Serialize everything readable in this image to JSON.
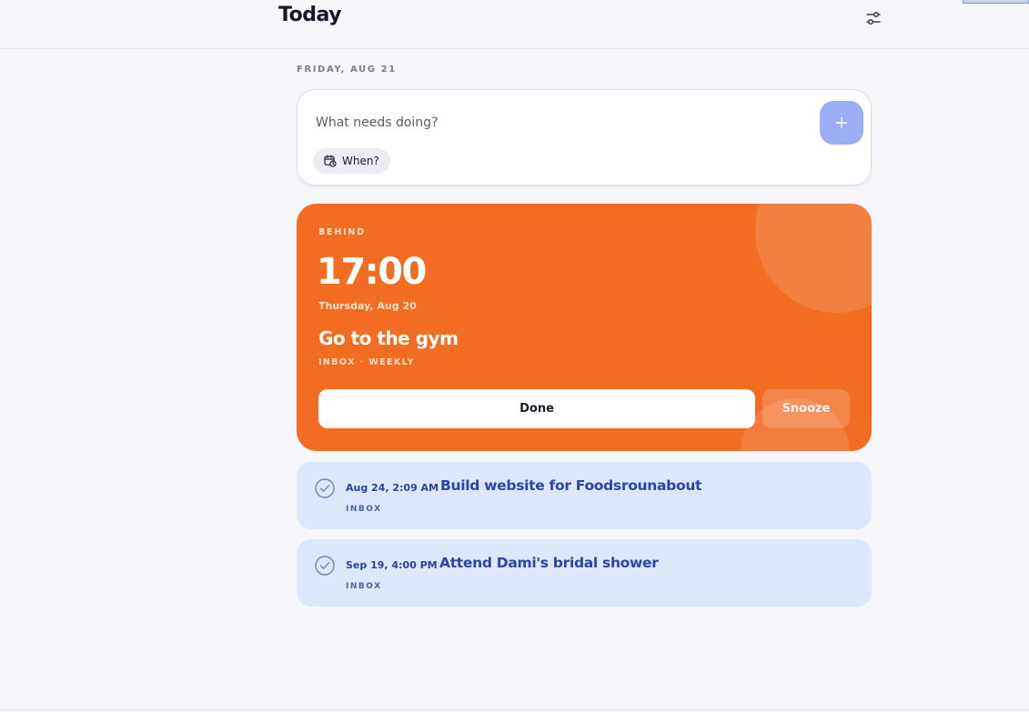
{
  "header": {
    "title": "Today",
    "settings_icon": "sliders-icon"
  },
  "date_heading": "FRIDAY, AUG 21",
  "composer": {
    "placeholder": "What needs doing?",
    "value": "",
    "add_icon": "plus-icon",
    "when_label": "When?",
    "when_icon": "calendar-clock-icon"
  },
  "focus_task": {
    "status": "BEHIND",
    "time": "17:00",
    "date": "Thursday, Aug 20",
    "title": "Go to the gym",
    "meta": "INBOX · WEEKLY",
    "done_label": "Done",
    "snooze_label": "Snooze"
  },
  "tasks": [
    {
      "when": "Aug 24, 2:09 AM",
      "title": "Build website for Foodsrounabout",
      "list": "INBOX"
    },
    {
      "when": "Sep 19, 4:00 PM",
      "title": "Attend Dami's bridal shower",
      "list": "INBOX"
    }
  ],
  "colors": {
    "accent_orange": "#f26c21",
    "add_button": "#9aaef6",
    "task_card": "#dce7fb",
    "task_title": "#2a45a8"
  }
}
